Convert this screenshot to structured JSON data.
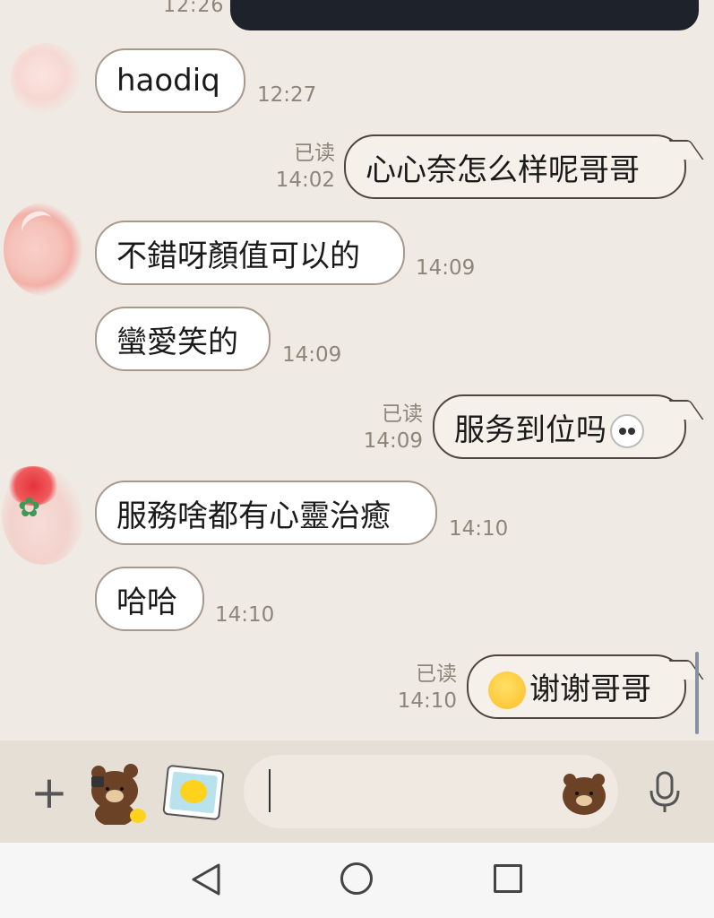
{
  "top": {
    "time": "12:26"
  },
  "messages": [
    {
      "side": "in",
      "text": "haodiq",
      "time": "12:27"
    },
    {
      "side": "out",
      "text": "心心奈怎么样呢哥哥",
      "read": "已读",
      "time": "14:02"
    },
    {
      "side": "in",
      "text": "不錯呀顏值可以的",
      "time": "14:09"
    },
    {
      "side": "in",
      "text": "蠻愛笑的",
      "time": "14:09"
    },
    {
      "side": "out",
      "text": "服务到位吗",
      "emoji": "white-face-icon",
      "read": "已读",
      "time": "14:09"
    },
    {
      "side": "in",
      "text": "服務啥都有心靈治癒",
      "time": "14:10"
    },
    {
      "side": "in",
      "text": "哈哈",
      "time": "14:10"
    },
    {
      "side": "out",
      "text": "谢谢哥哥",
      "emoji": "happy-sun-icon",
      "read": "已读",
      "time": "14:10"
    }
  ],
  "input": {
    "placeholder": ""
  },
  "colors": {
    "background": "#efebe4",
    "bubble_in": "#ffffff",
    "bubble_out": "#f5f0e9",
    "time_text": "#8e857a"
  }
}
